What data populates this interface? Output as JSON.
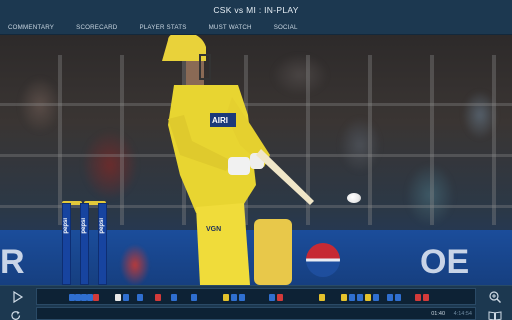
{
  "header": {
    "title": "CSK vs MI : IN-PLAY"
  },
  "nav": {
    "tabs": [
      {
        "label": "COMMENTARY"
      },
      {
        "label": "SCORECARD"
      },
      {
        "label": "PLAYER STATS"
      },
      {
        "label": "MUST WATCH"
      },
      {
        "label": "SOCIAL"
      }
    ]
  },
  "video": {
    "stump_text": "pepsi",
    "board_text_left": "R",
    "board_text_right": "OE",
    "jersey_text": "AIRI",
    "pads_text": "VGN"
  },
  "player": {
    "current_time": "01:40",
    "total_time": "4:14:54",
    "play_icon": "play-icon",
    "zoom_icon": "zoom-in-icon",
    "refresh_icon": "refresh-icon",
    "book_icon": "book-icon"
  },
  "colors": {
    "bar_bg": "#1c3850",
    "timeline_bg": "#0d2235",
    "marker_blue": "#2f6fd0",
    "marker_red": "#d23a3a",
    "marker_yellow": "#e4c22c",
    "marker_white": "#e8e8e8"
  }
}
